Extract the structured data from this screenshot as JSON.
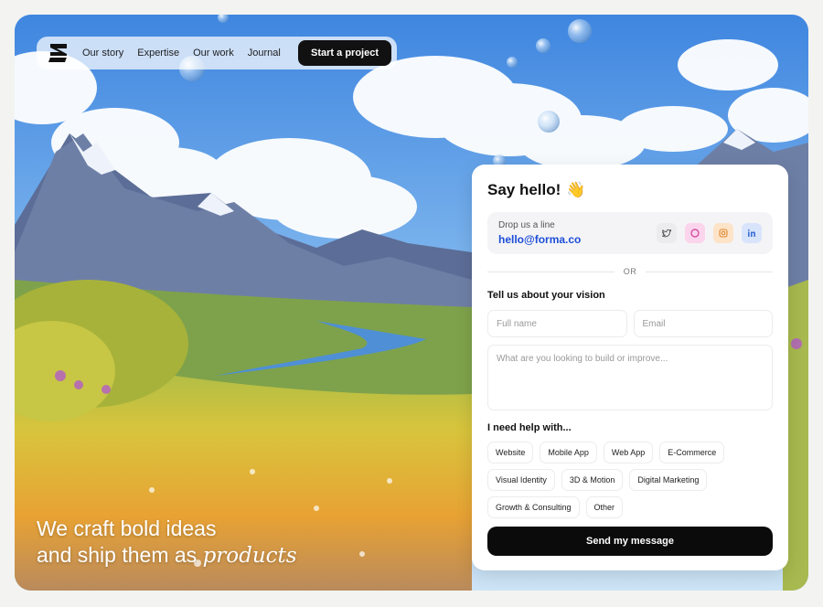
{
  "nav": {
    "links": [
      "Our story",
      "Expertise",
      "Our work",
      "Journal"
    ],
    "cta_label": "Start a project"
  },
  "hero": {
    "line1": "We craft bold ideas",
    "line2_prefix": "and ship them as ",
    "line2_emphasis": "products"
  },
  "contact_card": {
    "title": "Say hello!",
    "title_emoji": "👋",
    "drop_line_label": "Drop us a line",
    "email": "hello@forma.co",
    "socials": [
      "twitter-icon",
      "dribbble-icon",
      "instagram-icon",
      "linkedin-icon"
    ],
    "divider_text": "OR",
    "vision_title": "Tell us about your vision",
    "full_name_placeholder": "Full name",
    "email_placeholder": "Email",
    "message_placeholder": "What are you looking to build or improve...",
    "help_title": "I need help with...",
    "help_options": [
      "Website",
      "Mobile App",
      "Web App",
      "E-Commerce",
      "Visual Identity",
      "3D & Motion",
      "Digital Marketing",
      "Growth & Consulting",
      "Other"
    ],
    "send_label": "Send my message"
  },
  "colors": {
    "accent_link": "#1d4ed8",
    "button_dark": "#0b0b0c"
  }
}
